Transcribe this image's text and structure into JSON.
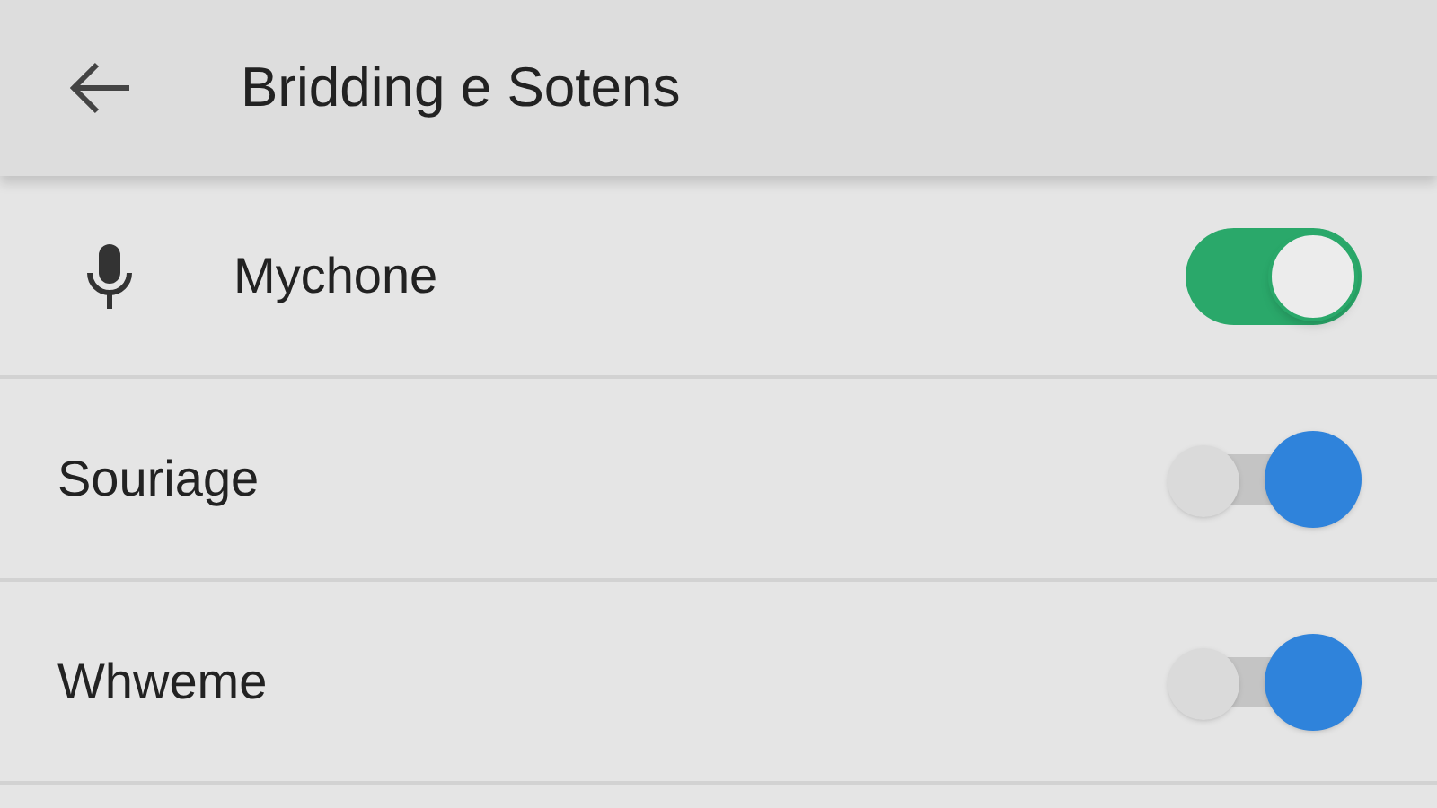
{
  "header": {
    "title": "Bridding e Sotens"
  },
  "settings": [
    {
      "kind": "pill",
      "label": "Mychone",
      "on": true
    },
    {
      "kind": "dot",
      "label": "Souriage",
      "on": true
    },
    {
      "kind": "dot",
      "label": "Whweme",
      "on": true
    }
  ]
}
